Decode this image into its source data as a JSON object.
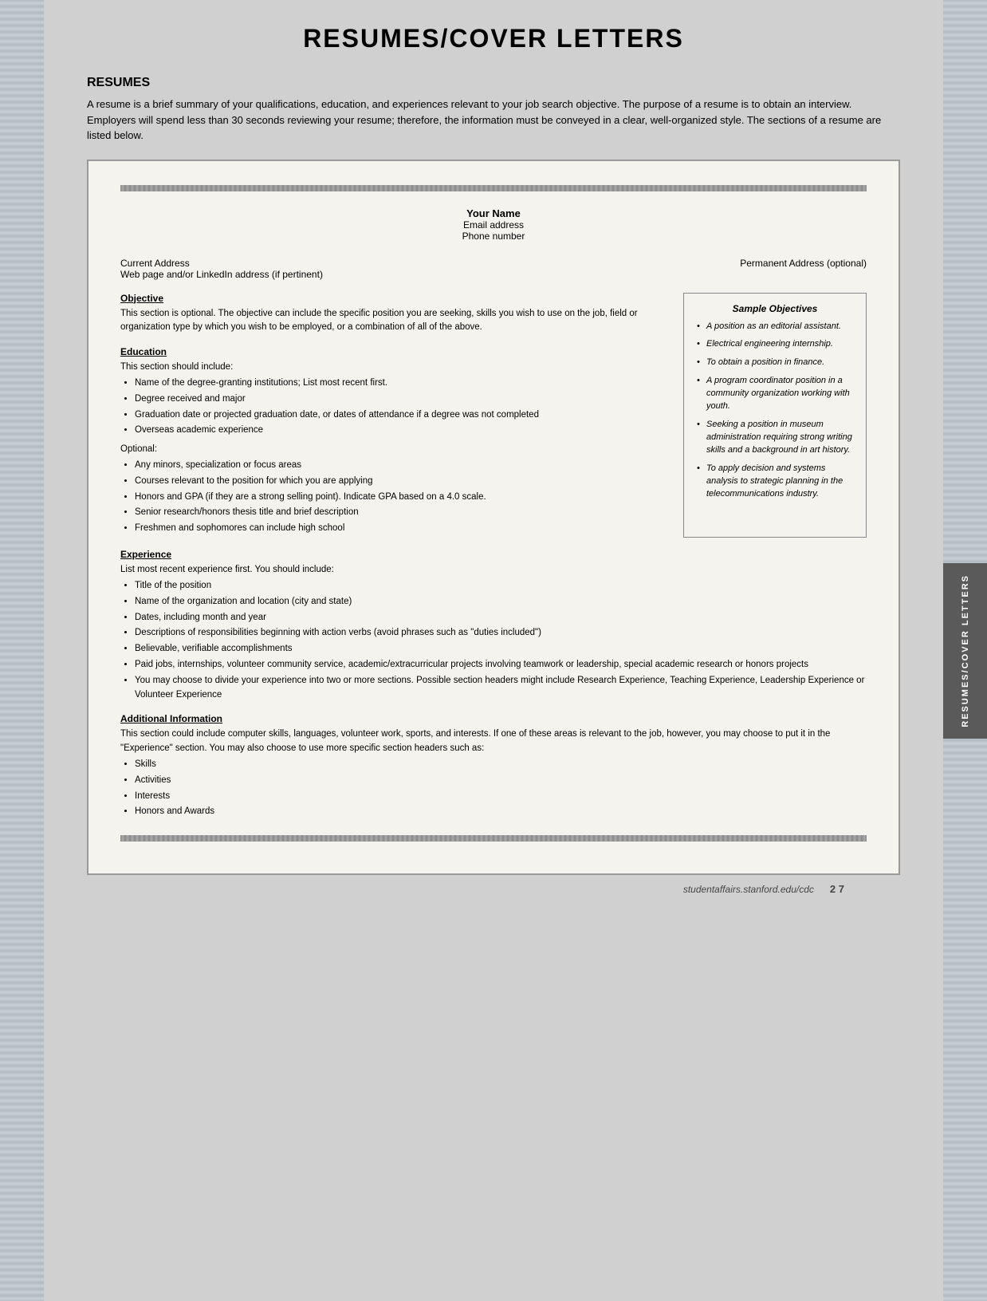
{
  "page": {
    "title": "RESUMES/COVER LETTERS"
  },
  "resumes_section": {
    "heading": "RESUMES",
    "intro": "A resume is a brief summary of your qualifications, education, and experiences relevant to your job search objective. The purpose of a resume is to obtain an interview. Employers will spend less than 30 seconds reviewing your resume; therefore, the information must be conveyed in a clear, well-organized style. The sections of a resume are listed below."
  },
  "document": {
    "name": "Your Name",
    "email": "Email address",
    "phone": "Phone number",
    "current_address": "Current Address",
    "web_page": "Web page and/or LinkedIn address (if pertinent)",
    "permanent_address": "Permanent Address (optional)",
    "sections": {
      "objective": {
        "title": "Objective",
        "text": "This section is optional. The objective can include the specific position you are seeking, skills you wish to use on the job, field or organization type by which you wish to be employed, or a combination of all of the above."
      },
      "education": {
        "title": "Education",
        "intro": "This section should include:",
        "items": [
          "Name of the degree-granting institutions; List most recent first.",
          "Degree received and major",
          "Graduation date or projected graduation date, or dates of attendance if a degree was not completed",
          "Overseas academic experience"
        ],
        "optional_label": "Optional:",
        "optional_items": [
          "Any minors, specialization or focus areas",
          "Courses relevant to the position for which you are applying",
          "Honors and GPA (if they are a strong selling point). Indicate GPA based on a 4.0 scale.",
          "Senior research/honors thesis title and brief description",
          "Freshmen and sophomores can include high school"
        ]
      },
      "experience": {
        "title": "Experience",
        "intro": "List most recent experience first. You should include:",
        "items": [
          "Title of the position",
          "Name of the organization and location (city and state)",
          "Dates, including month and year",
          "Descriptions of responsibilities beginning with action verbs (avoid phrases such as \"duties included\")",
          "Believable, verifiable accomplishments",
          "Paid jobs, internships, volunteer community service, academic/extracurricular projects involving teamwork or leadership, special academic research or honors projects",
          "You may choose to divide your experience into two or more sections. Possible section headers might include Research Experience, Teaching Experience, Leadership Experience or Volunteer Experience"
        ]
      },
      "additional": {
        "title": "Additional Information",
        "intro": "This section could include computer skills, languages, volunteer work, sports, and interests. If one of these areas is relevant to the job, however, you may choose to put it in the \"Experience\" section. You may also choose to use more specific section headers such as:",
        "items": [
          "Skills",
          "Activities",
          "Interests",
          "Honors and Awards"
        ]
      }
    },
    "sample_objectives": {
      "title": "Sample Objectives",
      "items": [
        "A position as an editorial assistant.",
        "Electrical engineering internship.",
        "To obtain a position in finance.",
        "A program coordinator position in a community organization working with youth.",
        "Seeking a position in museum administration requiring strong writing skills and a background in art history.",
        "To apply decision and systems analysis to strategic planning in the telecommunications industry."
      ]
    }
  },
  "footer": {
    "url": "studentaffairs.stanford.edu/cdc",
    "page": "2 7"
  },
  "right_tab": {
    "text": "RESUMES/COVER LETTERS"
  }
}
